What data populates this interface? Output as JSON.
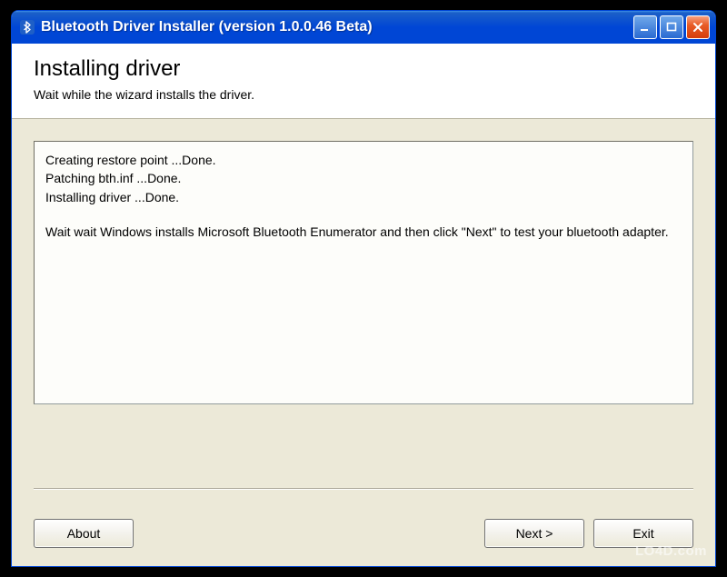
{
  "window": {
    "title": "Bluetooth Driver Installer (version 1.0.0.46 Beta)"
  },
  "header": {
    "title": "Installing driver",
    "subtitle": "Wait while the wizard installs the driver."
  },
  "log": {
    "lines": [
      "Creating restore point ...Done.",
      "Patching bth.inf ...Done.",
      "Installing driver ...Done."
    ],
    "message": "Wait wait Windows installs Microsoft Bluetooth Enumerator and then click \"Next\" to test your bluetooth adapter."
  },
  "buttons": {
    "about": "About",
    "next": "Next >",
    "exit": "Exit"
  },
  "watermark": "LO4D.com"
}
